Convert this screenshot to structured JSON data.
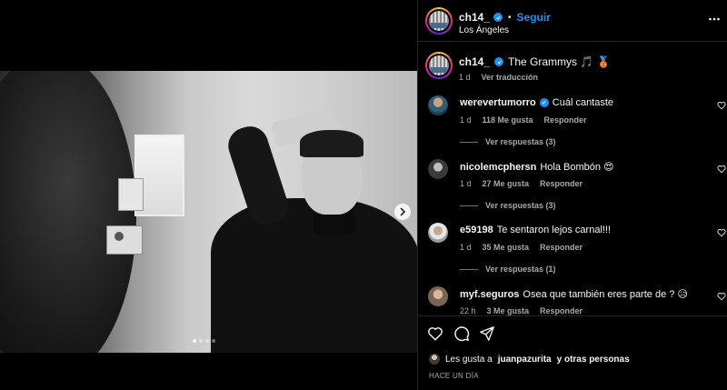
{
  "post": {
    "username": "ch14_",
    "follow_label": "Seguir",
    "location": "Los Ángeles",
    "caption": "The Grammys 🎵 🥉",
    "caption_time": "1 d",
    "see_translation": "Ver traducción",
    "carousel": {
      "current": 1,
      "total": 4
    }
  },
  "comments": [
    {
      "username": "werevertumorro",
      "verified": true,
      "text": "Cuál cantaste",
      "time": "1 d",
      "likes": "118 Me gusta",
      "reply": "Responder",
      "view_replies": "Ver respuestas (3)"
    },
    {
      "username": "nicolemcphersn",
      "verified": false,
      "text": "Hola Bombón 😍",
      "time": "1 d",
      "likes": "27 Me gusta",
      "reply": "Responder",
      "view_replies": "Ver respuestas (3)"
    },
    {
      "username": "e59198",
      "verified": false,
      "text": "Te sentaron lejos carnal!!!",
      "time": "1 d",
      "likes": "35 Me gusta",
      "reply": "Responder",
      "view_replies": "Ver respuestas (1)"
    },
    {
      "username": "myf.seguros",
      "verified": false,
      "text": "Osea que también eres parte de ? 😥",
      "time": "22 h",
      "likes": "3 Me gusta",
      "reply": "Responder",
      "view_replies": ""
    }
  ],
  "footer": {
    "likes_prefix": "Les gusta a",
    "liker": "juanpazurita",
    "likes_suffix": "y otras personas",
    "time_ago": "HACE UN DÍA"
  },
  "icons": {
    "like": "heart-icon",
    "comment": "comment-icon",
    "share": "share-icon",
    "more": "more-icon",
    "next": "chevron-right-icon",
    "verified": "verified-badge-icon"
  },
  "colors": {
    "background": "#000000",
    "link": "#1f8ef1",
    "secondary_text": "#a8a8a8"
  }
}
